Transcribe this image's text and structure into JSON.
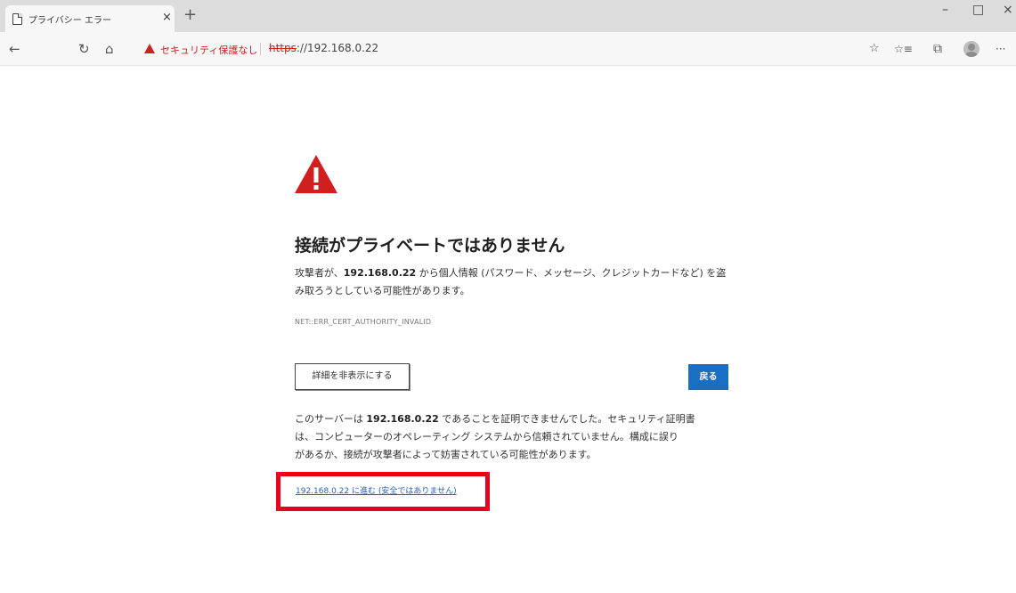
{
  "tab": {
    "title": "プライバシー エラー",
    "close_glyph": "×",
    "new_tab_glyph": "+"
  },
  "window_controls": {
    "minimize": "–",
    "maximize": "□",
    "close": "×"
  },
  "toolbar": {
    "back_glyph": "←",
    "refresh_glyph": "↻",
    "home_glyph": "⌂",
    "security_text": "セキュリティ保護なし",
    "url_scheme": "https",
    "url_rest": "://192.168.0.22",
    "favorite_glyph": "☆",
    "favorites_glyph": "☆≡",
    "collections_glyph": "⧉",
    "more_glyph": "···"
  },
  "page": {
    "heading": "接続がプライベートではありません",
    "intro_prefix": "攻撃者が、",
    "host": "192.168.0.22",
    "intro_suffix_line1": " から個人情報 (パスワード、メッセージ、クレジットカードなど) を盗",
    "intro_line2": "み取ろうとしている可能性があります。",
    "error_code": "NET::ERR_CERT_AUTHORITY_INVALID",
    "hide_details_label": "詳細を非表示にする",
    "back_label": "戻る",
    "details_prefix": "このサーバーは ",
    "details_suffix_line1": " であることを証明できませんでした。セキュリティ証明書",
    "details_line2": "は、コンピューターのオペレーティング システムから信頼されていません。構成に誤り",
    "details_line3": "があるか、接続が攻撃者によって妨害されている可能性があります。",
    "proceed_link": "192.168.0.22 に進む (安全ではありません)"
  },
  "colors": {
    "warning_red": "#cc2121",
    "primary_button": "#1a6fc4",
    "link": "#2b5fb5",
    "annotation_red": "#e8001c"
  }
}
